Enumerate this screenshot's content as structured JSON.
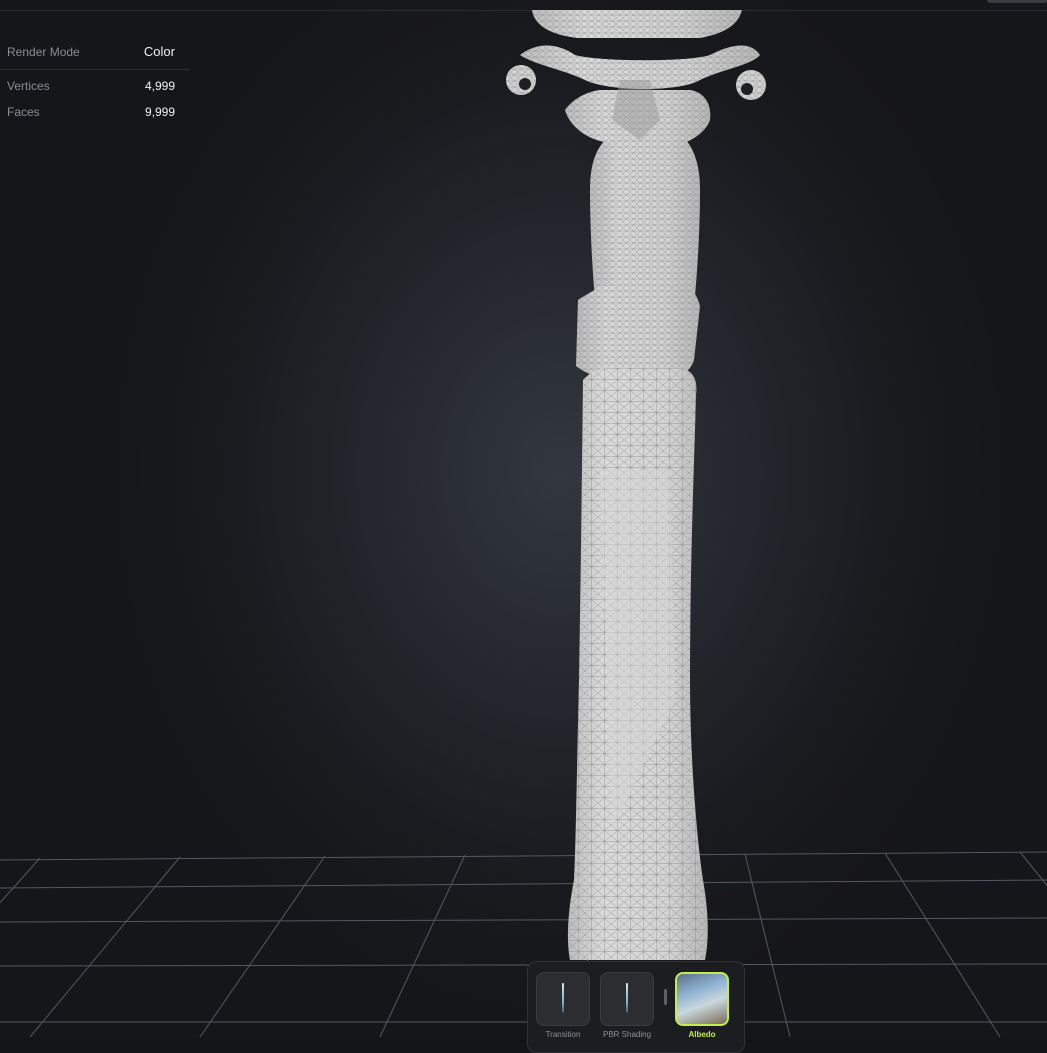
{
  "stats": {
    "render_mode_label": "Render Mode",
    "render_mode_value": "Color",
    "vertices_label": "Vertices",
    "vertices_value": "4,999",
    "faces_label": "Faces",
    "faces_value": "9,999"
  },
  "modes": [
    {
      "label": "Transition",
      "icon": "blade-icon",
      "active": false
    },
    {
      "label": "PBR Shading",
      "icon": "blade-icon",
      "active": false
    },
    {
      "label": "Albedo",
      "icon": "albedo-preview-thumbnail",
      "active": true
    }
  ],
  "colors": {
    "accent": "#c4ec4a",
    "model": "#d3d3d3",
    "background": "#24272d"
  }
}
